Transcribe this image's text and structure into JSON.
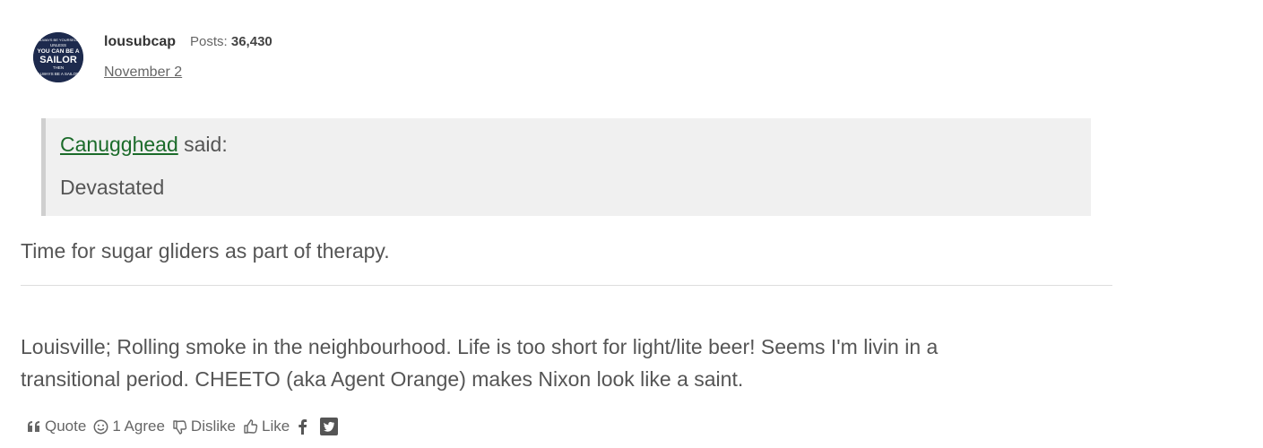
{
  "author": {
    "name": "lousubcap",
    "posts_label": "Posts:",
    "posts_count": "36,430",
    "date": "November 2",
    "avatar_lines": [
      "ALWAYS BE YOURSELF",
      "UNLESS",
      "YOU CAN BE A",
      "SAILOR",
      "THEN",
      "ALWAYS BE A SAILOR"
    ]
  },
  "quote": {
    "author": "Canugghead",
    "said": "said:",
    "text": "Devastated"
  },
  "post": {
    "text": "Time for sugar gliders as part of therapy."
  },
  "signature": {
    "line1": "Louisville; Rolling smoke in the neighbourhood.  Life is too short for light/lite beer!  Seems I'm livin in a",
    "line2": "transitional period. CHEETO (aka Agent Orange) makes Nixon look like a saint."
  },
  "reactions": {
    "quote_label": "Quote",
    "agree_label": "1 Agree",
    "dislike_label": "Dislike",
    "like_label": "Like"
  },
  "colors": {
    "link_green": "#1b6b2a",
    "quote_bg": "#f0f0f0",
    "avatar_navy": "#1d2a4d"
  }
}
